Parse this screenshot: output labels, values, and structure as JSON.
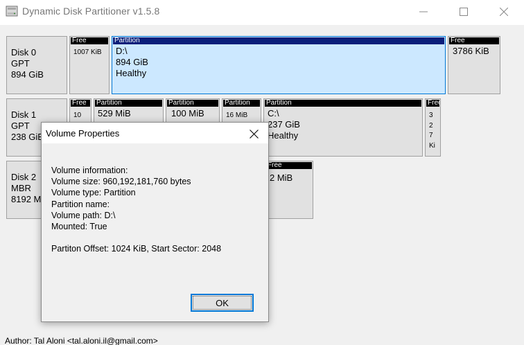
{
  "window": {
    "title": "Dynamic Disk Partitioner v1.5.8",
    "icon": "disk-drive-icon"
  },
  "disks": [
    {
      "name": "Disk 0",
      "style": "GPT",
      "size": "894 GiB",
      "partitions": [
        {
          "header": "Free",
          "lines": [
            "1007 KiB"
          ]
        },
        {
          "header": "Partition",
          "lines": [
            "D:\\",
            "894 GiB",
            "Healthy"
          ],
          "selected": true
        },
        {
          "header": "Free",
          "lines": [
            "3786 KiB"
          ]
        }
      ]
    },
    {
      "name": "Disk 1",
      "style": "GPT",
      "size": "238 GiB",
      "partitions": [
        {
          "header": "Free",
          "lines": [
            "10"
          ]
        },
        {
          "header": "Partition",
          "lines": [
            "529 MiB"
          ]
        },
        {
          "header": "Partition",
          "lines": [
            "100 MiB"
          ]
        },
        {
          "header": "Partition",
          "lines": [
            "16 MiB"
          ]
        },
        {
          "header": "Partition",
          "lines": [
            "C:\\",
            "237 GiB",
            "Healthy"
          ]
        },
        {
          "header": "Free",
          "lines": [
            "3",
            "2",
            "7",
            "Ki"
          ]
        }
      ]
    },
    {
      "name": "Disk 2",
      "style": "MBR",
      "size": "8192 MiB",
      "partitions": [
        {
          "header": "Free",
          "lines": [
            "2 MiB"
          ]
        }
      ]
    }
  ],
  "dialog": {
    "title": "Volume Properties",
    "lines": [
      "Volume information:",
      "Volume size: 960,192,181,760 bytes",
      "Volume type: Partition",
      "Partition name:",
      "Volume path: D:\\",
      "Mounted: True",
      "",
      "Partiton Offset: 1024 KiB, Start Sector: 2048"
    ],
    "ok_label": "OK"
  },
  "footer": {
    "author": "Author: Tal Aloni <tal.aloni.il@gmail.com>"
  }
}
